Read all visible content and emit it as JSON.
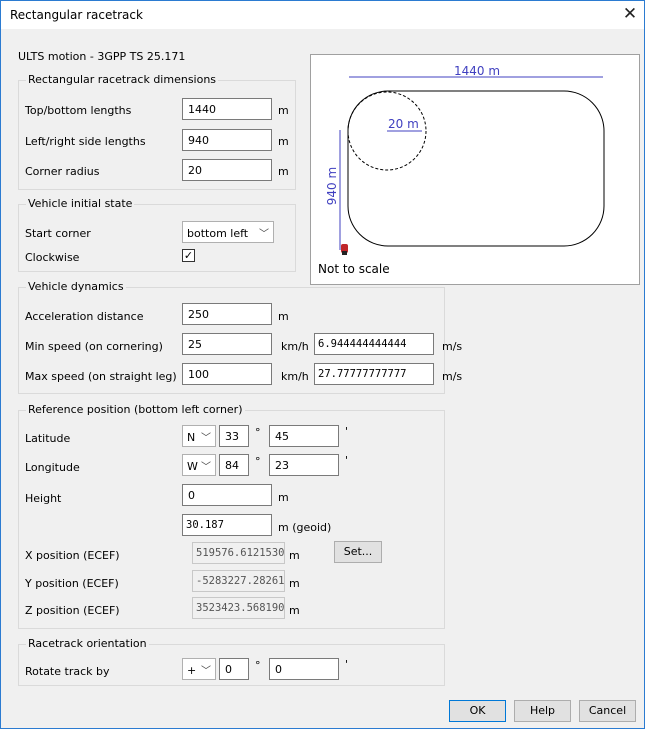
{
  "window": {
    "title": "Rectangular racetrack"
  },
  "header": {
    "model": "ULTS motion - 3GPP TS 25.171"
  },
  "dimensions": {
    "legend": "Rectangular racetrack dimensions",
    "top_bottom_label": "Top/bottom lengths",
    "top_bottom_value": "1440",
    "top_bottom_unit": "m",
    "left_right_label": "Left/right side lengths",
    "left_right_value": "940",
    "left_right_unit": "m",
    "corner_label": "Corner radius",
    "corner_value": "20",
    "corner_unit": "m"
  },
  "initial_state": {
    "legend": "Vehicle initial state",
    "start_corner_label": "Start corner",
    "start_corner_value": "bottom left",
    "clockwise_label": "Clockwise",
    "clockwise_checked": true,
    "check_glyph": "✓"
  },
  "dynamics": {
    "legend": "Vehicle dynamics",
    "accel_label": "Acceleration distance",
    "accel_value": "250",
    "accel_unit": "m",
    "min_label": "Min speed (on cornering)",
    "min_value": "25",
    "min_unit": "km/h",
    "min_ms_value": "6.944444444444",
    "min_ms_unit": "m/s",
    "max_label": "Max speed (on straight leg)",
    "max_value": "100",
    "max_unit": "km/h",
    "max_ms_value": "27.77777777777",
    "max_ms_unit": "m/s"
  },
  "reference": {
    "legend": "Reference position (bottom left corner)",
    "lat_label": "Latitude",
    "lat_hemi": "N",
    "lat_deg": "33",
    "lat_min": "45",
    "lon_label": "Longitude",
    "lon_hemi": "W",
    "lon_deg": "84",
    "lon_min": "23",
    "deg_symbol": "°",
    "min_symbol": "'",
    "height_label": "Height",
    "height_value": "0",
    "height_unit": "m",
    "geoid_value": "30.187",
    "geoid_unit": "m (geoid)",
    "x_label": "X position (ECEF)",
    "x_value": "519576.6121530",
    "x_unit": "m",
    "set_button": "Set...",
    "y_label": "Y position (ECEF)",
    "y_value": "-5283227.28261",
    "y_unit": "m",
    "z_label": "Z position (ECEF)",
    "z_value": "3523423.568190",
    "z_unit": "m"
  },
  "orientation": {
    "legend": "Racetrack orientation",
    "rotate_label": "Rotate track by",
    "sign_value": "+",
    "deg_value": "0",
    "min_value": "0"
  },
  "preview": {
    "top_dim": "1440 m",
    "side_dim": "940 m",
    "radius_dim": "20 m",
    "note": "Not to scale",
    "dim_color": "#4040c0"
  },
  "buttons": {
    "ok": "OK",
    "help": "Help",
    "cancel": "Cancel"
  }
}
